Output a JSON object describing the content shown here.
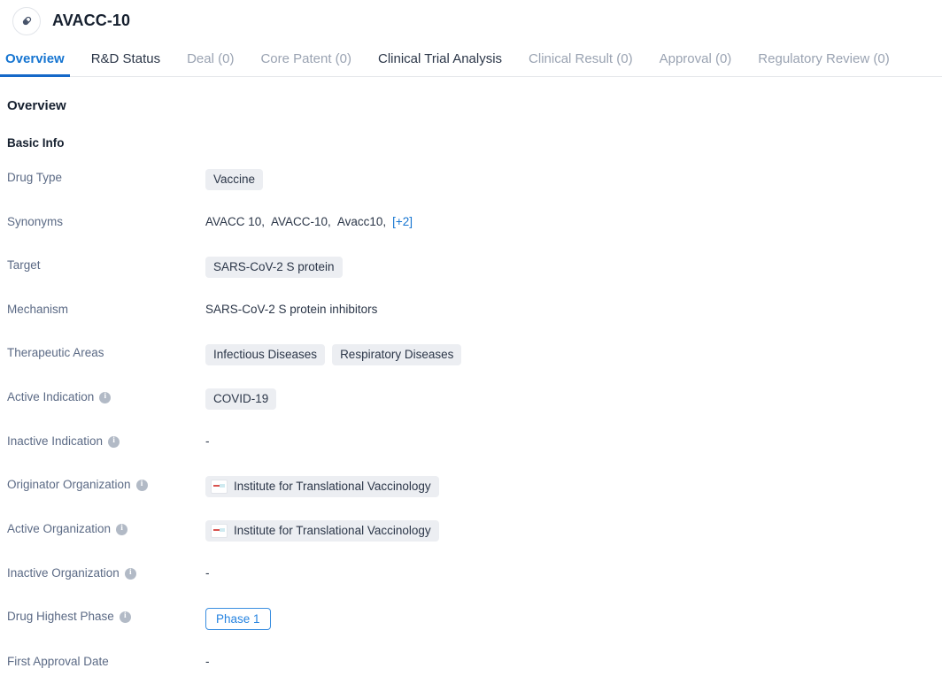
{
  "header": {
    "icon": "capsule-pill-icon",
    "title": "AVACC-10"
  },
  "tabs": [
    {
      "label": "Overview",
      "state": "active"
    },
    {
      "label": "R&D Status",
      "state": "enabled"
    },
    {
      "label": "Deal (0)",
      "state": "disabled"
    },
    {
      "label": "Core Patent (0)",
      "state": "disabled"
    },
    {
      "label": "Clinical Trial Analysis",
      "state": "enabled"
    },
    {
      "label": "Clinical Result (0)",
      "state": "disabled"
    },
    {
      "label": "Approval (0)",
      "state": "disabled"
    },
    {
      "label": "Regulatory Review (0)",
      "state": "disabled"
    }
  ],
  "overview": {
    "section_title": "Overview",
    "subsection_title": "Basic Info",
    "fields": {
      "drug_type": {
        "label": "Drug Type",
        "tags": [
          "Vaccine"
        ]
      },
      "synonyms": {
        "label": "Synonyms",
        "items": [
          "AVACC 10,",
          "AVACC-10,",
          "Avacc10,"
        ],
        "more": "[+2]"
      },
      "target": {
        "label": "Target",
        "tags": [
          "SARS-CoV-2 S protein"
        ]
      },
      "mechanism": {
        "label": "Mechanism",
        "text": "SARS-CoV-2 S protein inhibitors"
      },
      "therapeutic_areas": {
        "label": "Therapeutic Areas",
        "tags": [
          "Infectious Diseases",
          "Respiratory Diseases"
        ]
      },
      "active_indication": {
        "label": "Active Indication",
        "info": true,
        "tags": [
          "COVID-19"
        ]
      },
      "inactive_indication": {
        "label": "Inactive Indication",
        "info": true,
        "text": "-"
      },
      "originator_organization": {
        "label": "Originator Organization",
        "info": true,
        "org": "Institute for Translational Vaccinology"
      },
      "active_organization": {
        "label": "Active Organization",
        "info": true,
        "org": "Institute for Translational Vaccinology"
      },
      "inactive_organization": {
        "label": "Inactive Organization",
        "info": true,
        "text": "-"
      },
      "drug_highest_phase": {
        "label": "Drug Highest Phase",
        "info": true,
        "badge": "Phase 1"
      },
      "first_approval_date": {
        "label": "First Approval Date",
        "text": "-"
      }
    }
  },
  "colors": {
    "accent": "#1568c8",
    "label": "#5b6a85",
    "text": "#2b3648",
    "tag_bg": "#eceef2",
    "link": "#1675d1"
  }
}
